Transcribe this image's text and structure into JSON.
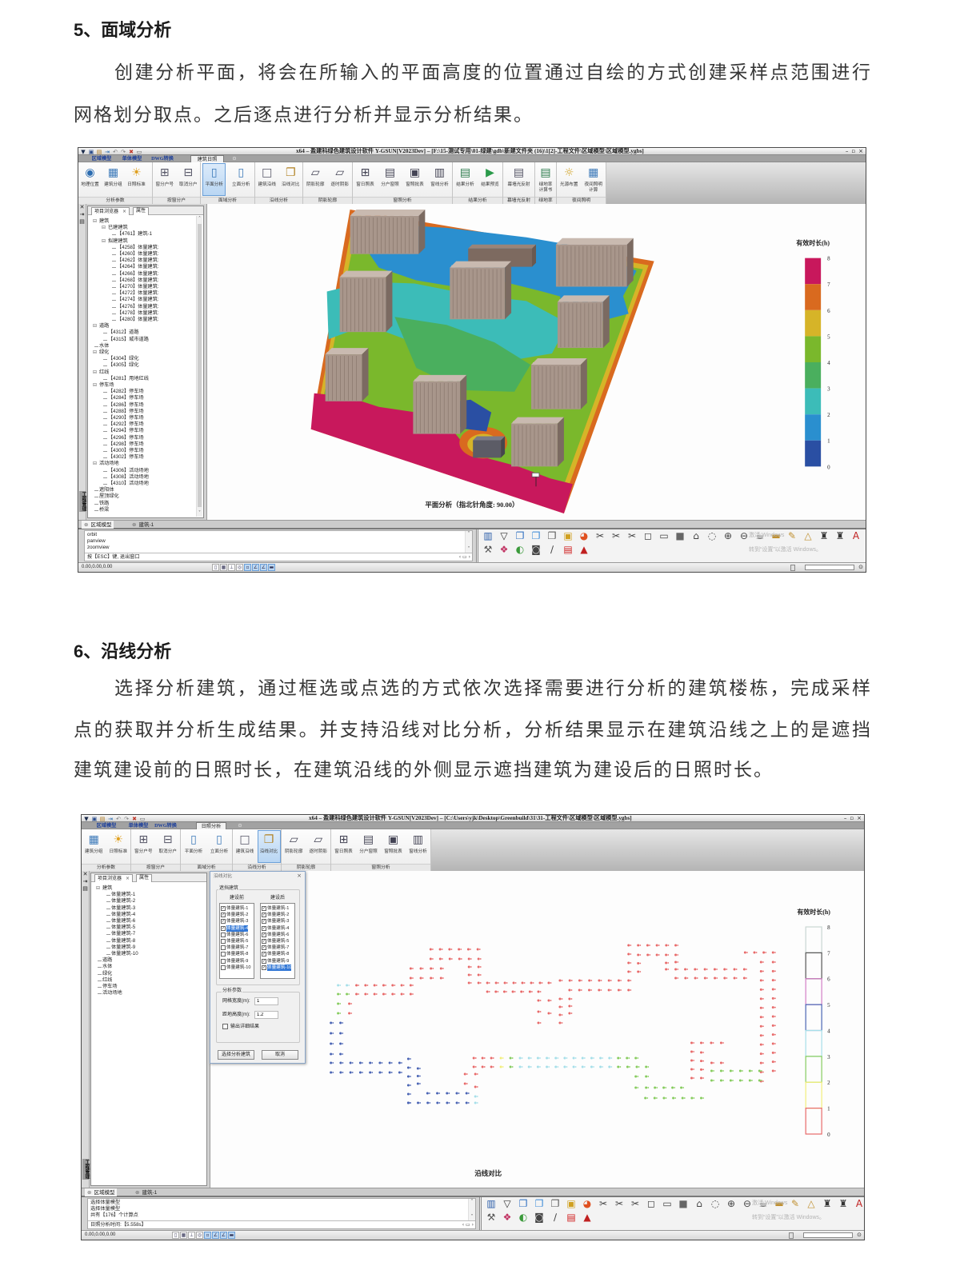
{
  "section5": {
    "heading": "5、面域分析",
    "lines": [
      "创建分析平面，将会在所输入的平面高度的位置通过自绘的方式创建采样点范围进行",
      "网格划分取点。之后逐点进行分析并显示分析结果。"
    ]
  },
  "section6": {
    "heading": "6、沿线分析",
    "lines": [
      "选择分析建筑，通过框选或点选的方式依次选择需要进行分析的建筑楼栋，完成采样",
      "点的获取并分析生成结果。并支持沿线对比分析，分析结果显示在建筑沿线之上的是遮挡",
      "建筑建设前的日照时长，在建筑沿线的外侧显示遮挡建筑为建设后的日照时长。"
    ]
  },
  "shot1": {
    "title": "x64 – 盈建科绿色建筑设计软件 Y-GSUN[V2023Dev] – [F:\\15-测试专用\\01-绿建\\gdb\\新建文件夹 (16)\\1[2]-工程文件\\区域模型\\区域模型.ygbs]",
    "quick_access": [
      "app-logo-icon",
      "save-icon",
      "save-as-icon",
      "export-icon",
      "undo-icon",
      "redo-icon",
      "delete-icon",
      "print-icon"
    ],
    "tabs": [
      {
        "label": "区域模型"
      },
      {
        "label": "单体模型"
      },
      {
        "label": "DWG转换"
      },
      {
        "label": "建筑日照",
        "active": true
      }
    ],
    "ribbon": [
      {
        "label": "分析参数",
        "buttons": [
          {
            "label": "地理位置",
            "icon": "globe-icon"
          },
          {
            "label": "建筑分组",
            "icon": "building-group-icon"
          },
          {
            "label": "日照标准",
            "icon": "sun-standard-icon"
          }
        ]
      },
      {
        "label": "按窗分户",
        "buttons": [
          {
            "label": "窗分户号",
            "icon": "window-number-icon"
          },
          {
            "label": "取消分户",
            "icon": "window-cancel-icon"
          }
        ]
      },
      {
        "label": "面域分析",
        "buttons": [
          {
            "label": "平面分析",
            "icon": "plane-analysis-icon",
            "active": true
          },
          {
            "label": "立面分析",
            "icon": "facade-analysis-icon"
          }
        ]
      },
      {
        "label": "沿线分析",
        "buttons": [
          {
            "label": "建筑沿线",
            "icon": "building-outline-icon"
          },
          {
            "label": "沿线对比",
            "icon": "outline-compare-icon"
          }
        ]
      },
      {
        "label": "阴影轮廓",
        "buttons": [
          {
            "label": "阴影轮廓",
            "icon": "shadow-outline-icon"
          },
          {
            "label": "逐时阴影",
            "icon": "hourly-shadow-icon"
          }
        ]
      },
      {
        "label": "窗照分析",
        "buttons": [
          {
            "label": "窗日照表",
            "icon": "window-table-icon"
          },
          {
            "label": "分户窗照",
            "icon": "unit-window-icon"
          },
          {
            "label": "窗照批表",
            "icon": "window-batch-icon"
          },
          {
            "label": "窗线分析",
            "icon": "window-line-icon"
          }
        ]
      },
      {
        "label": "结果分析",
        "buttons": [
          {
            "label": "结果分析",
            "icon": "result-analysis-icon"
          },
          {
            "label": "结果预览",
            "icon": "result-preview-icon"
          }
        ]
      },
      {
        "label": "幕墙光反射",
        "buttons": [
          {
            "label": "幕墙光反射",
            "icon": "curtain-wall-icon"
          }
        ]
      },
      {
        "label": "绿地率",
        "buttons": [
          {
            "label": "绿地率\n计算书",
            "icon": "green-ratio-icon"
          }
        ]
      },
      {
        "label": "夜间照明",
        "buttons": [
          {
            "label": "光源布置",
            "icon": "light-source-icon"
          },
          {
            "label": "夜间照明\n计算",
            "icon": "night-lighting-icon"
          }
        ]
      }
    ],
    "side_strip_label": "工程管理",
    "panel_tabs": {
      "browser": "项目浏览器",
      "properties": "属性"
    },
    "tree": [
      {
        "label": "建筑",
        "level": 0,
        "expander": "minus"
      },
      {
        "label": "已建建筑",
        "level": 1,
        "expander": "minus"
      },
      {
        "label": "【4761】建筑-1",
        "level": 2
      },
      {
        "label": "拟建建筑",
        "level": 1,
        "expander": "minus"
      },
      {
        "label": "【4258】体量建筑:",
        "level": 2
      },
      {
        "label": "【4260】体量建筑:",
        "level": 2
      },
      {
        "label": "【4262】体量建筑:",
        "level": 2
      },
      {
        "label": "【4264】体量建筑:",
        "level": 2
      },
      {
        "label": "【4266】体量建筑:",
        "level": 2
      },
      {
        "label": "【4268】体量建筑:",
        "level": 2
      },
      {
        "label": "【4270】体量建筑:",
        "level": 2
      },
      {
        "label": "【4272】体量建筑:",
        "level": 2
      },
      {
        "label": "【4274】体量建筑:",
        "level": 2
      },
      {
        "label": "【4276】体量建筑:",
        "level": 2
      },
      {
        "label": "【4278】体量建筑:",
        "level": 2
      },
      {
        "label": "【4280】体量建筑:",
        "level": 2
      },
      {
        "label": "道路",
        "level": 0,
        "expander": "minus"
      },
      {
        "label": "【4312】道路",
        "level": 1
      },
      {
        "label": "【4315】城市道路",
        "level": 1
      },
      {
        "label": "水体",
        "level": 0
      },
      {
        "label": "绿化",
        "level": 0,
        "expander": "minus"
      },
      {
        "label": "【4304】绿化",
        "level": 1
      },
      {
        "label": "【4305】绿化",
        "level": 1
      },
      {
        "label": "红线",
        "level": 0,
        "expander": "minus"
      },
      {
        "label": "【4281】用地红线",
        "level": 1
      },
      {
        "label": "停车场",
        "level": 0,
        "expander": "minus"
      },
      {
        "label": "【4282】停车场",
        "level": 1
      },
      {
        "label": "【4284】停车场",
        "level": 1
      },
      {
        "label": "【4286】停车场",
        "level": 1
      },
      {
        "label": "【4288】停车场",
        "level": 1
      },
      {
        "label": "【4290】停车场",
        "level": 1
      },
      {
        "label": "【4292】停车场",
        "level": 1
      },
      {
        "label": "【4294】停车场",
        "level": 1
      },
      {
        "label": "【4296】停车场",
        "level": 1
      },
      {
        "label": "【4298】停车场",
        "level": 1
      },
      {
        "label": "【4300】停车场",
        "level": 1
      },
      {
        "label": "【4302】停车场",
        "level": 1
      },
      {
        "label": "活动场地",
        "level": 0,
        "expander": "minus"
      },
      {
        "label": "【4306】活动场地",
        "level": 1
      },
      {
        "label": "【4308】活动场地",
        "level": 1
      },
      {
        "label": "【4310】活动场地",
        "level": 1
      },
      {
        "label": "遮阳体",
        "level": 0
      },
      {
        "label": "屋顶绿化",
        "level": 0
      },
      {
        "label": "铁路",
        "level": 0
      },
      {
        "label": "桥梁",
        "level": 0
      }
    ],
    "canvas_caption": "平面分析（指北针角度: 90.00）",
    "legend": {
      "title": "有效时长(h)",
      "ticks": [
        "8",
        "7",
        "6",
        "5",
        "4",
        "3",
        "2",
        "1",
        "0"
      ],
      "bands": [
        {
          "range": "7-8",
          "color": "#c8185c"
        },
        {
          "range": "6-7",
          "color": "#d96a1f"
        },
        {
          "range": "5-6",
          "color": "#d6b428"
        },
        {
          "range": "4-5",
          "color": "#7ab82c"
        },
        {
          "range": "3-4",
          "color": "#4aaf5e"
        },
        {
          "range": "2-3",
          "color": "#3cbcb8"
        },
        {
          "range": "1-2",
          "color": "#2a8fcf"
        },
        {
          "range": "0-1",
          "color": "#2a4fa3"
        }
      ]
    },
    "model_tabs": [
      "区域模型",
      "建筑-1"
    ],
    "command_lines": [
      "orbit",
      "panview",
      "zoomview"
    ],
    "command_prompt": "按【ESC】键, 退出窗口",
    "toolbar_row1": [
      "building-columns-icon",
      "filter-icon",
      "copy-icon",
      "copy-blue-icon",
      "copy-gray-icon",
      "document-bulb-icon",
      "color-wheel-icon",
      "scissors-icon",
      "scissors-icon",
      "scissors-icon",
      "cube-wire-icon",
      "cube-side-icon",
      "cube-solid-icon",
      "house-3d-icon",
      "lasso-icon",
      "zoom-in-icon",
      "zoom-out-icon",
      "teapot-icon",
      "ruler-icon",
      "pencil-ruler-icon",
      "triangle-ruler-icon",
      "antenna-tower-icon",
      "antenna-tower-icon",
      "text-style-icon"
    ],
    "toolbar_row2": [
      "wrench-icon",
      "chain-icon",
      "light-hand-icon",
      "camera-icon",
      "slope-icon",
      "pdf-icon",
      "cone-icon"
    ],
    "watermark": [
      "激活 Windows",
      "转到“设置”以激活 Windows。"
    ],
    "status_coords": "0.00,0.00,0.00"
  },
  "shot2": {
    "title": "x64 – 盈建科绿色建筑设计软件 Y-GSUN[V2023Dev] – [C:\\Users\\yjk\\Desktop\\Greenbuild\\31\\31-工程文件\\区域模型\\区域模型.ygbs]",
    "quick_access": [
      "app-logo-icon",
      "save-icon",
      "save-as-icon",
      "export-icon",
      "undo-icon",
      "redo-icon",
      "delete-icon",
      "print-icon"
    ],
    "tabs": [
      {
        "label": "区域模型"
      },
      {
        "label": "单体模型"
      },
      {
        "label": "DWG转换"
      },
      {
        "label": "日照分析",
        "active": true
      }
    ],
    "ribbon": [
      {
        "label": "分析参数",
        "buttons": [
          {
            "label": "建筑分组",
            "icon": "building-group-icon"
          },
          {
            "label": "日照标准",
            "icon": "sun-standard-icon"
          }
        ]
      },
      {
        "label": "按窗分户",
        "buttons": [
          {
            "label": "窗分户号",
            "icon": "window-number-icon"
          },
          {
            "label": "取消分户",
            "icon": "window-cancel-icon"
          }
        ]
      },
      {
        "label": "面域分析",
        "buttons": [
          {
            "label": "平面分析",
            "icon": "plane-analysis-icon"
          },
          {
            "label": "立面分析",
            "icon": "facade-analysis-icon"
          }
        ]
      },
      {
        "label": "沿线分析",
        "buttons": [
          {
            "label": "建筑沿线",
            "icon": "building-outline-icon"
          },
          {
            "label": "沿线对比",
            "icon": "outline-compare-icon",
            "active": true
          }
        ]
      },
      {
        "label": "阴影轮廓",
        "buttons": [
          {
            "label": "阴影轮廓",
            "icon": "shadow-outline-icon"
          },
          {
            "label": "逐时阴影",
            "icon": "hourly-shadow-icon"
          }
        ]
      },
      {
        "label": "窗照分析",
        "buttons": [
          {
            "label": "窗日照表",
            "icon": "window-table-icon"
          },
          {
            "label": "分户窗照",
            "icon": "unit-window-icon"
          },
          {
            "label": "窗照批表",
            "icon": "window-batch-icon"
          },
          {
            "label": "窗线分析",
            "icon": "window-line-icon"
          }
        ]
      }
    ],
    "side_strip_label": "工程管理",
    "panel_tabs": {
      "browser": "项目浏览器",
      "properties": "属性"
    },
    "tree": [
      {
        "label": "建筑",
        "level": 0,
        "expander": "minus"
      },
      {
        "label": "体量建筑-1",
        "level": 1
      },
      {
        "label": "体量建筑-2",
        "level": 1
      },
      {
        "label": "体量建筑-3",
        "level": 1
      },
      {
        "label": "体量建筑-4",
        "level": 1
      },
      {
        "label": "体量建筑-6",
        "level": 1
      },
      {
        "label": "体量建筑-5",
        "level": 1
      },
      {
        "label": "体量建筑-7",
        "level": 1
      },
      {
        "label": "体量建筑-8",
        "level": 1
      },
      {
        "label": "体量建筑-9",
        "level": 1
      },
      {
        "label": "体量建筑-10",
        "level": 1
      },
      {
        "label": "道路",
        "level": 0
      },
      {
        "label": "水体",
        "level": 0
      },
      {
        "label": "绿化",
        "level": 0
      },
      {
        "label": "红线",
        "level": 0
      },
      {
        "label": "停车场",
        "level": 0
      },
      {
        "label": "活动场地",
        "level": 0
      }
    ],
    "dialog": {
      "title": "沿线对比",
      "group_blocking": "遮挡建筑",
      "col_before": "建设前",
      "col_after": "建设后",
      "before_items": [
        {
          "label": "体量建筑-1",
          "checked": true
        },
        {
          "label": "体量建筑-2",
          "checked": true
        },
        {
          "label": "体量建筑-3",
          "checked": true
        },
        {
          "label": "体量建筑-4",
          "checked": true,
          "selected": true
        },
        {
          "label": "体量建筑-6",
          "checked": false
        },
        {
          "label": "体量建筑-5",
          "checked": false
        },
        {
          "label": "体量建筑-7",
          "checked": false
        },
        {
          "label": "体量建筑-8",
          "checked": false
        },
        {
          "label": "体量建筑-9",
          "checked": false
        },
        {
          "label": "体量建筑-10",
          "checked": false
        }
      ],
      "after_items": [
        {
          "label": "体量建筑-1",
          "checked": true
        },
        {
          "label": "体量建筑-2",
          "checked": true
        },
        {
          "label": "体量建筑-3",
          "checked": true
        },
        {
          "label": "体量建筑-4",
          "checked": true
        },
        {
          "label": "体量建筑-6",
          "checked": true
        },
        {
          "label": "体量建筑-5",
          "checked": true
        },
        {
          "label": "体量建筑-7",
          "checked": true
        },
        {
          "label": "体量建筑-8",
          "checked": true
        },
        {
          "label": "体量建筑-9",
          "checked": true
        },
        {
          "label": "体量建筑-10",
          "checked": true,
          "selected": true
        }
      ],
      "group_params": "分析参数",
      "grid_width_label": "网格宽度(m):",
      "grid_width_value": "1",
      "height_label": "距地高度(m):",
      "height_value": "1.2",
      "detail_checkbox_label": "输出详细结果",
      "detail_checked": false,
      "select_button": "选择分析建筑",
      "cancel_button": "取消"
    },
    "canvas_caption": "沿线对比",
    "legend": {
      "title": "有效时长(h)",
      "ticks": [
        "8",
        "7",
        "6",
        "5",
        "4",
        "3",
        "2",
        "1",
        "0"
      ],
      "bands": [
        {
          "range": "7-8",
          "color": "#c9d6d2"
        },
        {
          "range": "6-7",
          "color": "#555555"
        },
        {
          "range": "5-6",
          "color": "#d27ec6"
        },
        {
          "range": "4-5",
          "color": "#4a64b4"
        },
        {
          "range": "3-4",
          "color": "#a6dfe9"
        },
        {
          "range": "2-3",
          "color": "#86cc5e"
        },
        {
          "range": "1-2",
          "color": "#f2ee7a"
        },
        {
          "range": "0-1",
          "color": "#e86a6a"
        }
      ]
    },
    "model_tabs": [
      "区域模型",
      "建筑-1"
    ],
    "command_lines": [
      "选择体量模型",
      "选择体量模型",
      "共有【176】个计算点"
    ],
    "command_prompt": "日照分析时间:【5.558s】",
    "toolbar_row1": [
      "building-columns-icon",
      "filter-icon",
      "copy-icon",
      "copy-blue-icon",
      "copy-gray-icon",
      "document-bulb-icon",
      "color-wheel-icon",
      "scissors-icon",
      "scissors-icon",
      "scissors-icon",
      "cube-wire-icon",
      "cube-side-icon",
      "cube-solid-icon",
      "house-3d-icon",
      "lasso-icon",
      "zoom-in-icon",
      "zoom-out-icon",
      "teapot-icon",
      "ruler-icon",
      "pencil-ruler-icon",
      "triangle-ruler-icon",
      "antenna-tower-icon",
      "antenna-tower-icon",
      "text-style-icon"
    ],
    "toolbar_row2": [
      "wrench-icon",
      "chain-icon",
      "light-hand-icon",
      "camera-icon",
      "slope-icon",
      "pdf-icon",
      "cone-icon"
    ],
    "watermark": [
      "激活 Windows",
      "转到“设置”以激活 Windows。"
    ],
    "status_coords": "0.00,0.00,0.00"
  }
}
